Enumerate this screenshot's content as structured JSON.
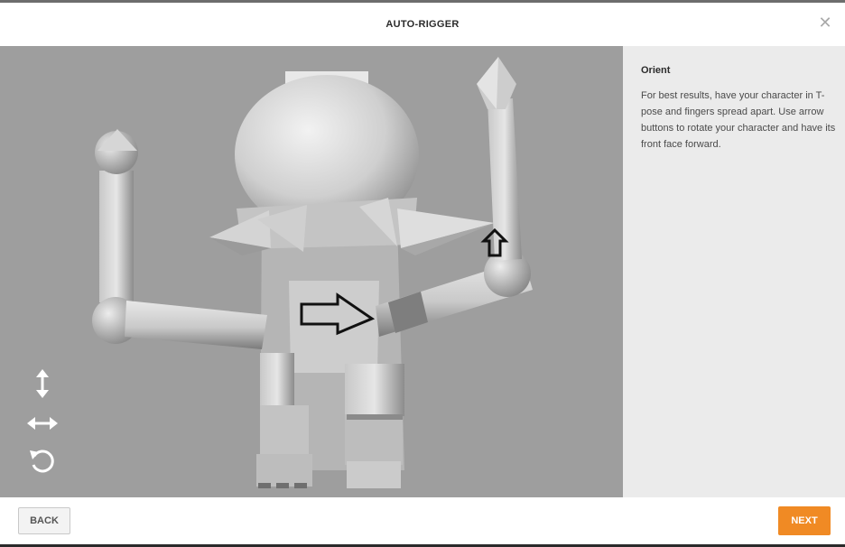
{
  "dialog": {
    "title": "AUTO-RIGGER",
    "close_icon": "close-icon"
  },
  "panel": {
    "heading": "Orient",
    "instructions": "For best results, have your character in T-pose and fingers spread apart. Use arrow buttons to rotate your character and have its front face forward."
  },
  "toolbar": {
    "tools": [
      {
        "name": "vertical-rotate",
        "icon": "vertical-arrow-icon"
      },
      {
        "name": "horizontal-rotate",
        "icon": "horizontal-arrow-icon"
      },
      {
        "name": "reset-rotation",
        "icon": "reset-icon"
      }
    ]
  },
  "footer": {
    "back_label": "BACK",
    "next_label": "NEXT"
  },
  "colors": {
    "viewport_bg": "#9e9e9e",
    "panel_bg": "#ebebeb",
    "accent": "#f08a24"
  }
}
